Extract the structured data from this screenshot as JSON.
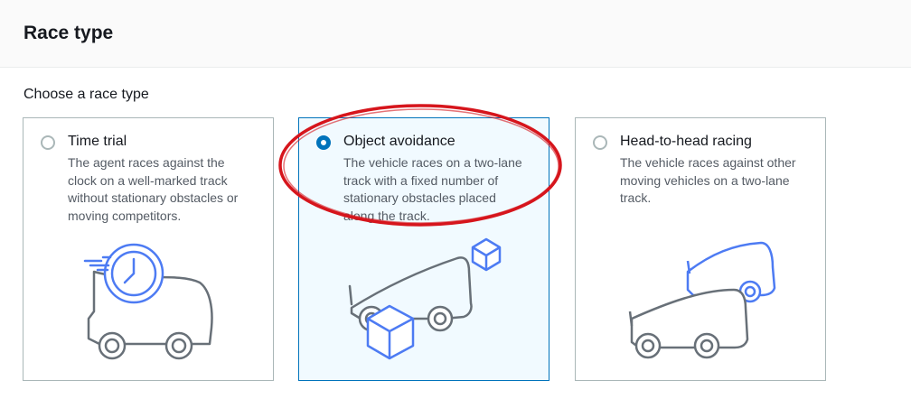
{
  "section": {
    "title": "Race type"
  },
  "race_type": {
    "label": "Choose a race type",
    "options": [
      {
        "title": "Time trial",
        "description": "The agent races against the clock on a well-marked track without stationary obstacles or moving competitors.",
        "selected": false,
        "illustration": "car-with-clock-icon"
      },
      {
        "title": "Object avoidance",
        "description": "The vehicle races on a two-lane track with a fixed number of stationary obstacles placed along the track.",
        "selected": true,
        "illustration": "car-with-boxes-icon"
      },
      {
        "title": "Head-to-head racing",
        "description": "The vehicle races against other moving vehicles on a two-lane track.",
        "selected": false,
        "illustration": "two-cars-icon"
      }
    ]
  },
  "colors": {
    "accent": "#0073bb",
    "illustration_blue": "#4d7bf3",
    "illustration_gray": "#687078",
    "annotation": "#d6151c"
  }
}
